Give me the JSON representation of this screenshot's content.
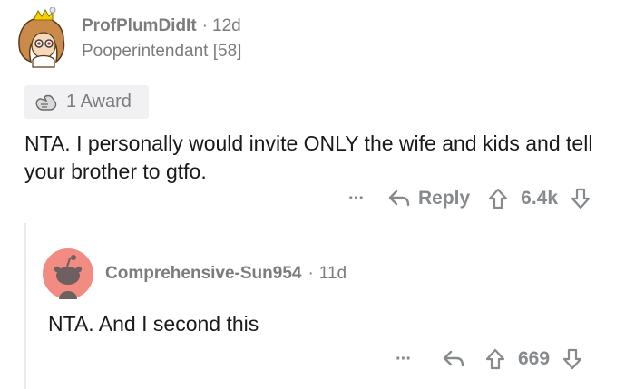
{
  "top_comment": {
    "username": "ProfPlumDidIt",
    "separator": "·",
    "age": "12d",
    "flair": "Pooperintendant [58]",
    "award_text": "1 Award",
    "body": "NTA. I personally would invite ONLY the wife and kids and tell your brother to gtfo.",
    "more": "···",
    "reply_label": "Reply",
    "score": "6.4k"
  },
  "reply_comment": {
    "username": "Comprehensive-Sun954",
    "separator": "·",
    "age": "11d",
    "body": "NTA. And I second this",
    "more": "···",
    "score": "669"
  },
  "icons": {
    "top_avatar": "cartoon-avatar-icon",
    "reply_avatar": "snoo-avatar-icon",
    "award": "award-icon",
    "reply": "reply-arrow-icon",
    "upvote": "upvote-icon",
    "downvote": "downvote-icon"
  },
  "colors": {
    "muted": "#7c7c7c",
    "action_gray": "#878a8c",
    "reply_avatar_bg": "#f28b82"
  }
}
